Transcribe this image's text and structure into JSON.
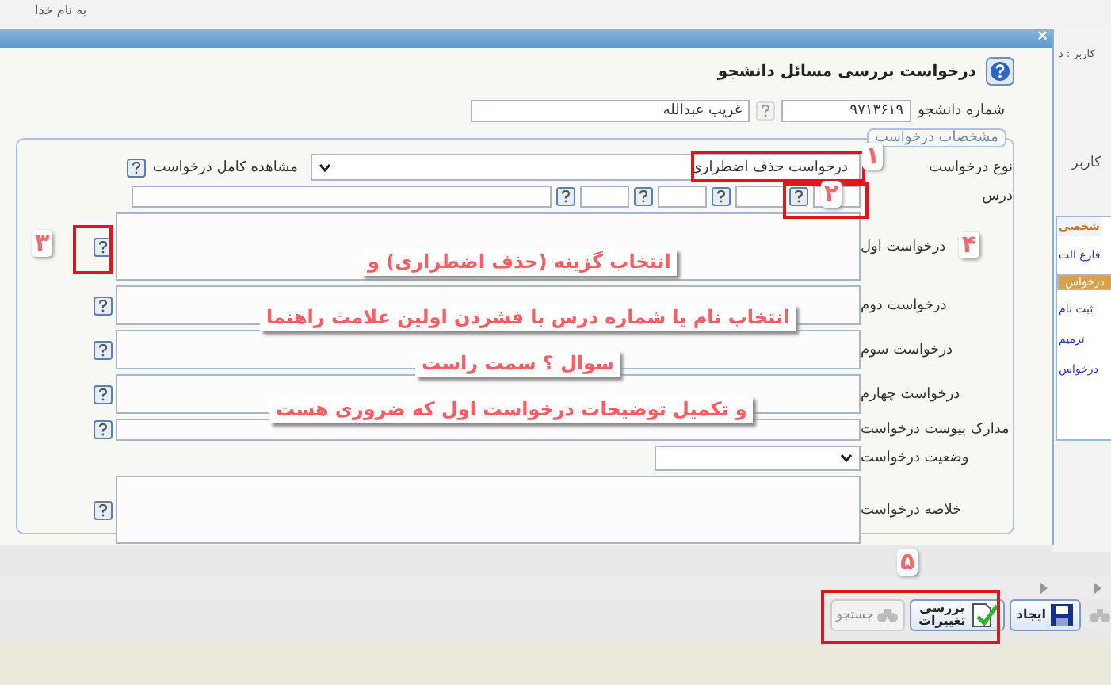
{
  "page": {
    "greeting": "به نام خدا",
    "user_label": "کاربر : د",
    "user_label_2": "کاربر",
    "side_tab": "شخصی",
    "side_links": [
      {
        "label": "فارغ الت",
        "selected": false
      },
      {
        "label": "درخواس",
        "selected": true
      },
      {
        "label": "ثبت نام",
        "selected": false
      },
      {
        "label": "ترمیم",
        "selected": false
      },
      {
        "label": "درخواس",
        "selected": false
      }
    ]
  },
  "dialog": {
    "close": "×",
    "title": "درخواست بررسی مسائل دانشجو",
    "student": {
      "label": "شماره دانشجو",
      "number": "۹۷۱۳۶۱۹",
      "name": "غریب عبدالله"
    },
    "fieldset": "مشخصات درخواست",
    "request_type": {
      "label": "نوع درخواست",
      "value": "درخواست حذف اضطراری",
      "view_full": "مشاهده کامل درخواست"
    },
    "course": {
      "label": "درس"
    },
    "fields": [
      {
        "kind": "large_textarea",
        "label": "درخواست اول"
      },
      {
        "kind": "textarea",
        "label": "درخواست دوم"
      },
      {
        "kind": "textarea",
        "label": "درخواست سوم"
      },
      {
        "kind": "textarea",
        "label": "درخواست چهارم"
      },
      {
        "kind": "input",
        "label": "مدارک پیوست درخواست"
      },
      {
        "kind": "select",
        "label": "وضعیت درخواست"
      },
      {
        "kind": "large_textarea",
        "label": "خلاصه درخواست"
      }
    ]
  },
  "toolbar": {
    "buttons": [
      {
        "kind": "save",
        "label": "ایجاد",
        "disabled": false
      },
      {
        "kind": "check",
        "label": "بررسی تغییرات",
        "disabled": false
      },
      {
        "kind": "search",
        "label": "جستجو",
        "disabled": true
      }
    ]
  },
  "annotations": {
    "markers": [
      "۱",
      "۲",
      "۳",
      "۴",
      "۵"
    ],
    "captions": [
      "انتخاب گزینه (حذف اضطراری) و",
      "انتخاب نام یا شماره درس با فشردن اولین علامت راهنما",
      "سوال ؟ سمت راست",
      "و تکمیل توضیحات درخواست اول که ضروری هست"
    ]
  }
}
